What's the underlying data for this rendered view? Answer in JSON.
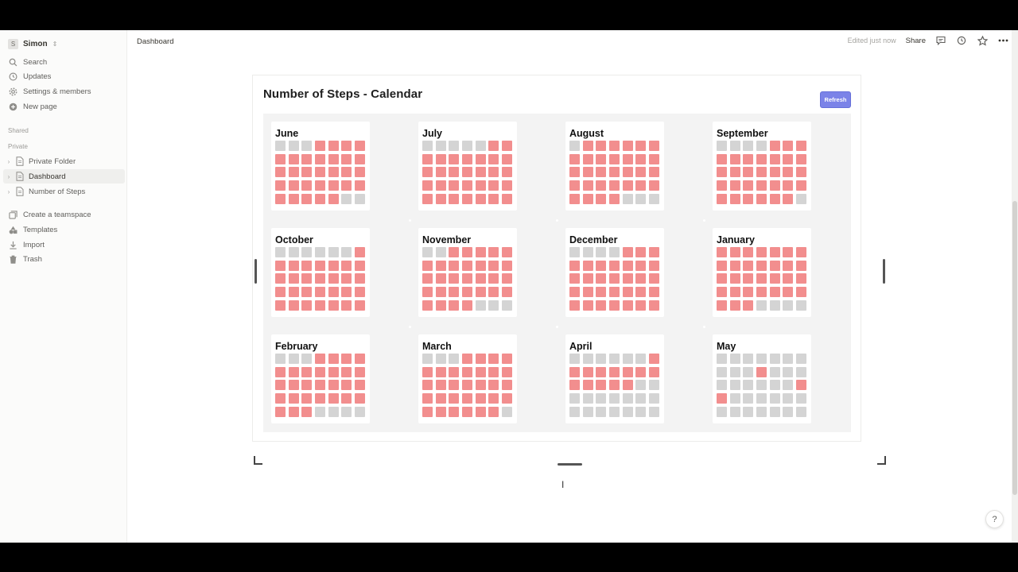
{
  "sidebar": {
    "workspace": {
      "avatar": "S",
      "name": "Simon",
      "chevron": "⌃⌄"
    },
    "nav": [
      {
        "label": "Search",
        "icon": "search-icon"
      },
      {
        "label": "Updates",
        "icon": "clock-icon"
      },
      {
        "label": "Settings & members",
        "icon": "gear-icon"
      },
      {
        "label": "New page",
        "icon": "plus-circle-icon"
      }
    ],
    "shared_label": "Shared",
    "private_label": "Private",
    "pages": [
      {
        "label": "Private Folder",
        "active": false
      },
      {
        "label": "Dashboard",
        "active": true
      },
      {
        "label": "Number of Steps",
        "active": false
      }
    ],
    "bottom": [
      {
        "label": "Create a teamspace",
        "icon": "teamspace-icon"
      },
      {
        "label": "Templates",
        "icon": "templates-icon"
      },
      {
        "label": "Import",
        "icon": "download-icon"
      },
      {
        "label": "Trash",
        "icon": "trash-icon"
      }
    ]
  },
  "topbar": {
    "breadcrumb": "Dashboard",
    "edited": "Edited just now",
    "share": "Share"
  },
  "embed": {
    "title": "Number of Steps - Calendar",
    "refresh_label": "Refresh",
    "colors": {
      "active": "#f28e8e",
      "inactive": "#d4d4d4"
    },
    "months": [
      {
        "name": "June",
        "cells": [
          0,
          0,
          0,
          1,
          1,
          1,
          1,
          1,
          1,
          1,
          1,
          1,
          1,
          1,
          1,
          1,
          1,
          1,
          1,
          1,
          1,
          1,
          1,
          1,
          1,
          1,
          1,
          1,
          1,
          1,
          1,
          1,
          1,
          0,
          0
        ]
      },
      {
        "name": "July",
        "cells": [
          0,
          0,
          0,
          0,
          0,
          1,
          1,
          1,
          1,
          1,
          1,
          1,
          1,
          1,
          1,
          1,
          1,
          1,
          1,
          1,
          1,
          1,
          1,
          1,
          1,
          1,
          1,
          1,
          1,
          1,
          1,
          1,
          1,
          1,
          1
        ]
      },
      {
        "name": "August",
        "cells": [
          0,
          1,
          1,
          1,
          1,
          1,
          1,
          1,
          1,
          1,
          1,
          1,
          1,
          1,
          1,
          1,
          1,
          1,
          1,
          1,
          1,
          1,
          1,
          1,
          1,
          1,
          1,
          1,
          1,
          1,
          1,
          1,
          0,
          0,
          0
        ]
      },
      {
        "name": "September",
        "cells": [
          0,
          0,
          0,
          0,
          1,
          1,
          1,
          1,
          1,
          1,
          1,
          1,
          1,
          1,
          1,
          1,
          1,
          1,
          1,
          1,
          1,
          1,
          1,
          1,
          1,
          1,
          1,
          1,
          1,
          1,
          1,
          1,
          1,
          1,
          0
        ]
      },
      {
        "name": "October",
        "cells": [
          0,
          0,
          0,
          0,
          0,
          0,
          1,
          1,
          1,
          1,
          1,
          1,
          1,
          1,
          1,
          1,
          1,
          1,
          1,
          1,
          1,
          1,
          1,
          1,
          1,
          1,
          1,
          1,
          1,
          1,
          1,
          1,
          1,
          1,
          1
        ]
      },
      {
        "name": "November",
        "cells": [
          0,
          0,
          1,
          1,
          1,
          1,
          1,
          1,
          1,
          1,
          1,
          1,
          1,
          1,
          1,
          1,
          1,
          1,
          1,
          1,
          1,
          1,
          1,
          1,
          1,
          1,
          1,
          1,
          1,
          1,
          1,
          1,
          0,
          0,
          0
        ]
      },
      {
        "name": "December",
        "cells": [
          0,
          0,
          0,
          0,
          1,
          1,
          1,
          1,
          1,
          1,
          1,
          1,
          1,
          1,
          1,
          1,
          1,
          1,
          1,
          1,
          1,
          1,
          1,
          1,
          1,
          1,
          1,
          1,
          1,
          1,
          1,
          1,
          1,
          1,
          1
        ]
      },
      {
        "name": "January",
        "cells": [
          1,
          1,
          1,
          1,
          1,
          1,
          1,
          1,
          1,
          1,
          1,
          1,
          1,
          1,
          1,
          1,
          1,
          1,
          1,
          1,
          1,
          1,
          1,
          1,
          1,
          1,
          1,
          1,
          1,
          1,
          1,
          0,
          0,
          0,
          0
        ]
      },
      {
        "name": "February",
        "cells": [
          0,
          0,
          0,
          1,
          1,
          1,
          1,
          1,
          1,
          1,
          1,
          1,
          1,
          1,
          1,
          1,
          1,
          1,
          1,
          1,
          1,
          1,
          1,
          1,
          1,
          1,
          1,
          1,
          1,
          1,
          1,
          0,
          0,
          0,
          0
        ]
      },
      {
        "name": "March",
        "cells": [
          0,
          0,
          0,
          1,
          1,
          1,
          1,
          1,
          1,
          1,
          1,
          1,
          1,
          1,
          1,
          1,
          1,
          1,
          1,
          1,
          1,
          1,
          1,
          1,
          1,
          1,
          1,
          1,
          1,
          1,
          1,
          1,
          1,
          1,
          0
        ]
      },
      {
        "name": "April",
        "cells": [
          0,
          0,
          0,
          0,
          0,
          0,
          1,
          1,
          1,
          1,
          1,
          1,
          1,
          1,
          1,
          1,
          1,
          1,
          1,
          0,
          0,
          0,
          0,
          0,
          0,
          0,
          0,
          0,
          0,
          0,
          0,
          0,
          0,
          0,
          0
        ]
      },
      {
        "name": "May",
        "cells": [
          0,
          0,
          0,
          0,
          0,
          0,
          0,
          0,
          0,
          0,
          1,
          0,
          0,
          0,
          0,
          0,
          0,
          0,
          0,
          0,
          1,
          1,
          0,
          0,
          0,
          0,
          0,
          0,
          0,
          0,
          0,
          0,
          0,
          0,
          0
        ]
      }
    ]
  },
  "help_label": "?"
}
